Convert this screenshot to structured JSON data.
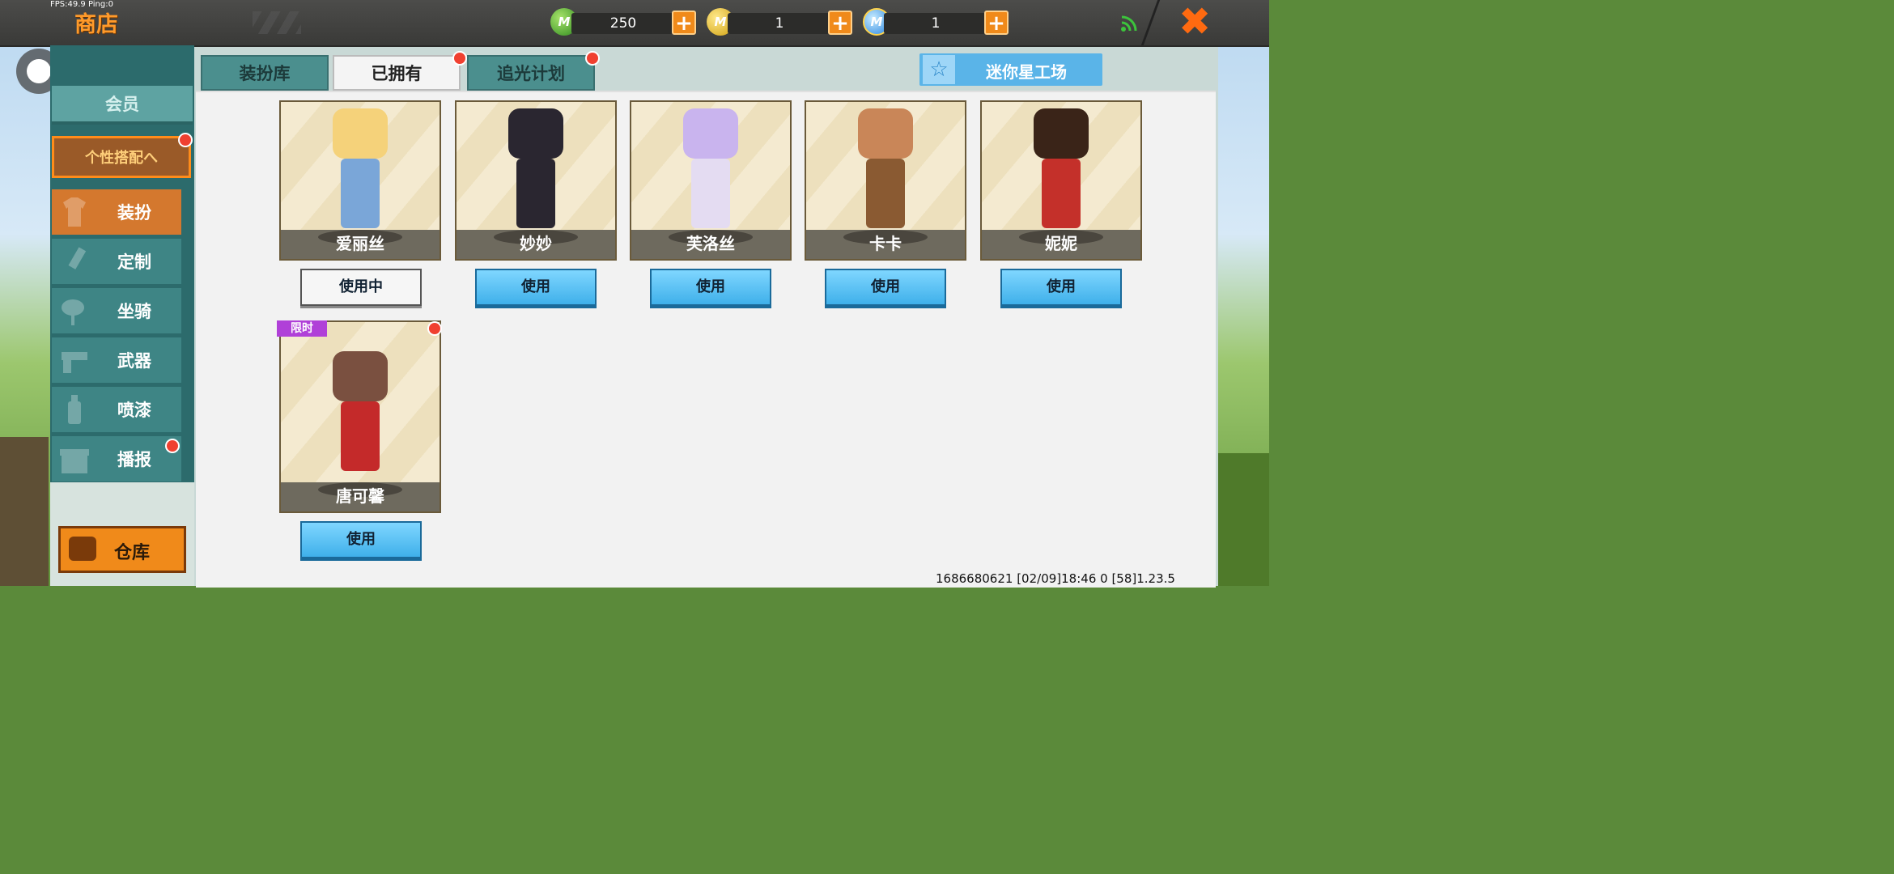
{
  "hud": {
    "fps_text": "FPS:49.9  Ping:0",
    "shop_title": "商店",
    "currencies": [
      {
        "icon": "mini-bean-icon",
        "letter": "M",
        "value": "250"
      },
      {
        "icon": "mini-coin-icon",
        "letter": "M",
        "value": "1"
      },
      {
        "icon": "mini-point-icon",
        "letter": "M",
        "value": "1"
      }
    ],
    "plus_symbol": "+",
    "close_symbol": "✖"
  },
  "sidebar": {
    "member": "会员",
    "personal": "个性搭配へ",
    "items": [
      {
        "label": "装扮",
        "icon": "shirt-icon",
        "active": true
      },
      {
        "label": "定制",
        "icon": "brush-icon",
        "active": false
      },
      {
        "label": "坐骑",
        "icon": "saddle-icon",
        "active": false
      },
      {
        "label": "武器",
        "icon": "gun-icon",
        "active": false
      },
      {
        "label": "喷漆",
        "icon": "spray-icon",
        "active": false
      },
      {
        "label": "播报",
        "icon": "gift-icon",
        "active": false
      }
    ],
    "warehouse": "仓库"
  },
  "tabs": [
    {
      "label": "装扮库",
      "active": false
    },
    {
      "label": "已拥有",
      "active": true
    },
    {
      "label": "追光计划",
      "active": false
    }
  ],
  "star_factory": {
    "label": "迷你星工场",
    "icon": "star-icon"
  },
  "skins": [
    {
      "name": "爱丽丝",
      "button": "使用中",
      "in_use": true,
      "colors": {
        "head": "#f5d27a",
        "body": "#7aa6d8"
      }
    },
    {
      "name": "妙妙",
      "button": "使用",
      "in_use": false,
      "colors": {
        "head": "#2a2630",
        "body": "#2a2630"
      }
    },
    {
      "name": "芙洛丝",
      "button": "使用",
      "in_use": false,
      "colors": {
        "head": "#c9b4ee",
        "body": "#e4dcf2"
      }
    },
    {
      "name": "卡卡",
      "button": "使用",
      "in_use": false,
      "colors": {
        "head": "#c98658",
        "body": "#8a5a32"
      }
    },
    {
      "name": "妮妮",
      "button": "使用",
      "in_use": false,
      "colors": {
        "head": "#3a2418",
        "body": "#c4302a"
      }
    },
    {
      "name": "唐可馨",
      "button": "使用",
      "in_use": false,
      "limited": "限时",
      "colors": {
        "head": "#7a5040",
        "body": "#c42a2a"
      }
    }
  ],
  "footer": "1686680621    [02/09]18:46 0  [58]1.23.5"
}
